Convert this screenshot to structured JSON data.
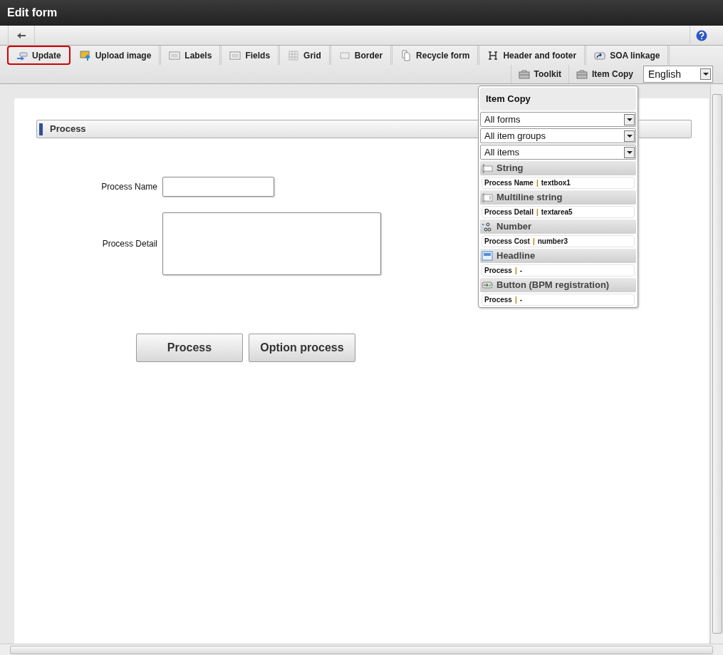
{
  "window": {
    "title": "Edit form"
  },
  "tabs": [
    {
      "label": "Update",
      "highlighted": true
    },
    {
      "label": "Upload image",
      "highlighted": false
    },
    {
      "label": "Labels",
      "highlighted": false
    },
    {
      "label": "Fields",
      "highlighted": false
    },
    {
      "label": "Grid",
      "highlighted": false
    },
    {
      "label": "Border",
      "highlighted": false
    },
    {
      "label": "Recycle form",
      "highlighted": false
    },
    {
      "label": "Header and footer",
      "highlighted": false
    },
    {
      "label": "SOA linkage",
      "highlighted": false
    }
  ],
  "tools": [
    {
      "label": "Toolkit"
    },
    {
      "label": "Item Copy"
    }
  ],
  "language": {
    "value": "English"
  },
  "form": {
    "section": "Process",
    "fields": [
      {
        "label": "Process Name",
        "kind": "text"
      },
      {
        "label": "Process Detail",
        "kind": "textarea"
      }
    ],
    "buttons": [
      "Process",
      "Option process"
    ]
  },
  "item_copy": {
    "title": "Item Copy",
    "filters": [
      "All forms",
      "All item groups",
      "All items"
    ],
    "groups": [
      {
        "kind": "string",
        "name": "String",
        "items": [
          {
            "label": "Process Name",
            "separator": "|",
            "ref": "textbox1"
          }
        ]
      },
      {
        "kind": "multiline",
        "name": "Multiline string",
        "items": [
          {
            "label": "Process Detail",
            "separator": "|",
            "ref": "textarea5"
          }
        ]
      },
      {
        "kind": "number",
        "name": "Number",
        "items": [
          {
            "label": "Process Cost",
            "separator": "|",
            "ref": "number3"
          }
        ]
      },
      {
        "kind": "headline",
        "name": "Headline",
        "items": [
          {
            "label": "Process",
            "separator": "|",
            "ref": "-"
          }
        ]
      },
      {
        "kind": "button",
        "name": "Button (BPM registration)",
        "items": [
          {
            "label": "Process",
            "separator": "|",
            "ref": "-"
          }
        ]
      }
    ]
  }
}
